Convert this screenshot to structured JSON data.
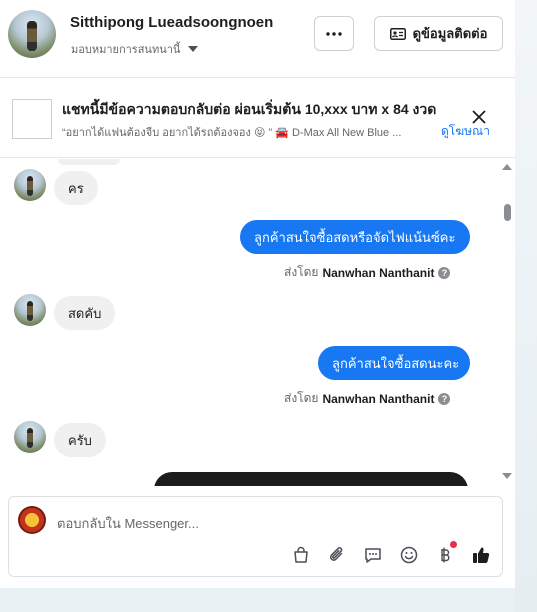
{
  "header": {
    "contact_name": "Sitthipong Lueadsoongnoen",
    "assign_label": "มอบหมายการสนทนานี้",
    "more_label": "···",
    "contact_info_label": "ดูข้อมูลติดต่อ"
  },
  "ad_banner": {
    "title": "แชทนี้มีข้อความตอบกลับต่อ ผ่อนเริ่มต้น 10,xxx บาท x 84 งวด",
    "snippet": "“อยากได้แฟนต้องจีบ อยากได้รถต้องจอง 😝 ” 🚘 D-Max All New Blue ...",
    "link_label": "ดูโฆษณา"
  },
  "messages": [
    {
      "direction": "in",
      "text": "คร"
    },
    {
      "direction": "out",
      "text": "ลูกค้าสนใจซื้อสดหรือจัดไฟแน้นซ์คะ",
      "sent_by_prefix": "ส่งโดย",
      "sent_by": "Nanwhan Nanthanit"
    },
    {
      "direction": "in",
      "text": "สดคับ"
    },
    {
      "direction": "out",
      "text": "ลูกค้าสนใจซื้อสดนะคะ",
      "sent_by_prefix": "ส่งโดย",
      "sent_by": "Nanwhan Nanthanit"
    },
    {
      "direction": "in",
      "text": "ครับ"
    }
  ],
  "composer": {
    "placeholder": "ตอบกลับใน Messenger..."
  },
  "icons": [
    "more-icon",
    "contact-card-icon",
    "close-icon",
    "info-icon",
    "shopping-bag-icon",
    "attach-icon",
    "chat-icon",
    "emoji-icon",
    "baht-icon",
    "like-icon"
  ],
  "colors": {
    "accent": "#1877f2",
    "notification": "#f02849"
  }
}
